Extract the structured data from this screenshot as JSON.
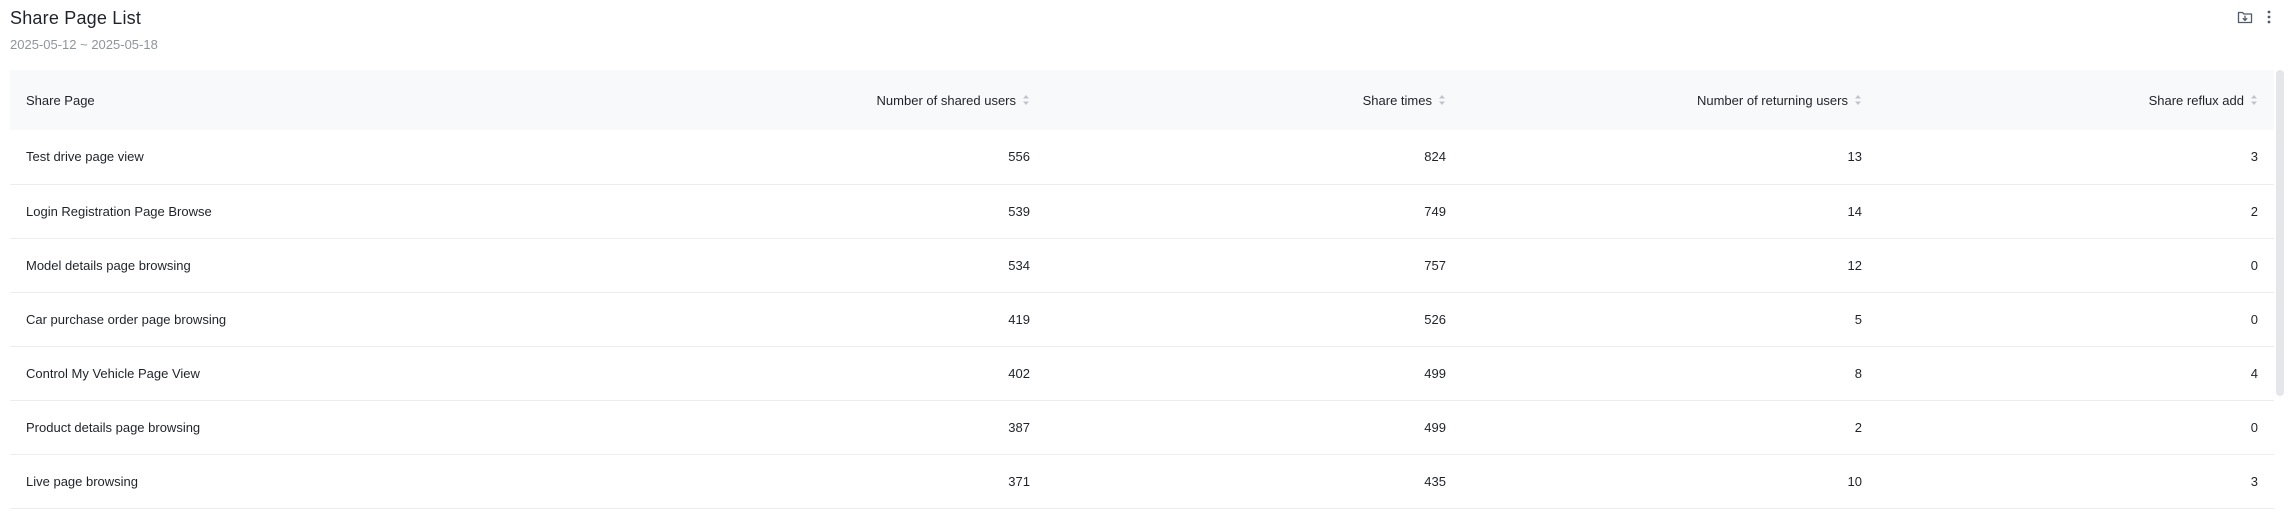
{
  "header": {
    "title": "Share Page List",
    "date_range": "2025-05-12 ~ 2025-05-18",
    "actions": [
      {
        "icon": "folder-download-icon"
      },
      {
        "icon": "more-vertical-icon"
      }
    ]
  },
  "table": {
    "columns": [
      {
        "label": "Share Page",
        "sortable": false
      },
      {
        "label": "Number of shared users",
        "sortable": true
      },
      {
        "label": "Share times",
        "sortable": true
      },
      {
        "label": "Number of returning users",
        "sortable": true
      },
      {
        "label": "Share reflux add",
        "sortable": true
      }
    ],
    "rows": [
      {
        "page": "Test drive page view",
        "shared_users": "556",
        "share_times": "824",
        "returning_users": "13",
        "reflux_add": "3"
      },
      {
        "page": "Login Registration Page Browse",
        "shared_users": "539",
        "share_times": "749",
        "returning_users": "14",
        "reflux_add": "2"
      },
      {
        "page": "Model details page browsing",
        "shared_users": "534",
        "share_times": "757",
        "returning_users": "12",
        "reflux_add": "0"
      },
      {
        "page": "Car purchase order page browsing",
        "shared_users": "419",
        "share_times": "526",
        "returning_users": "5",
        "reflux_add": "0"
      },
      {
        "page": "Control My Vehicle Page View",
        "shared_users": "402",
        "share_times": "499",
        "returning_users": "8",
        "reflux_add": "4"
      },
      {
        "page": "Product details page browsing",
        "shared_users": "387",
        "share_times": "499",
        "returning_users": "2",
        "reflux_add": "0"
      },
      {
        "page": "Live page browsing",
        "shared_users": "371",
        "share_times": "435",
        "returning_users": "10",
        "reflux_add": "3"
      }
    ]
  }
}
